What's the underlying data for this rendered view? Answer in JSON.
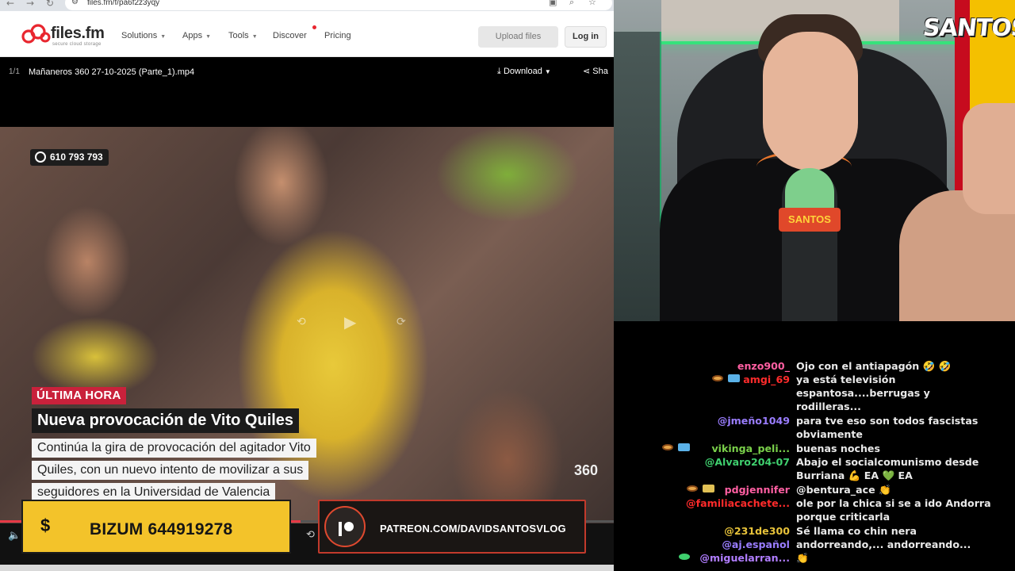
{
  "browser": {
    "url": "files.fm/f/pa6f2z3yqy",
    "logo_text": "files.fm",
    "logo_sub": "secure cloud storage",
    "menu": [
      {
        "label": "Solutions"
      },
      {
        "label": "Apps"
      },
      {
        "label": "Tools"
      },
      {
        "label": "Discover"
      },
      {
        "label": "Pricing"
      }
    ],
    "upload_label": "Upload files",
    "login_label": "Log in",
    "file_count": "1/1",
    "file_name": "Mañaneros 360 27-10-2025 (Parte_1).mp4",
    "download_label": "Download",
    "share_label": "Sha",
    "progress_fraction": 0.49
  },
  "video": {
    "whatsapp_number": "610 793 793",
    "tag": "ÚLTIMA HORA",
    "headline": "Nueva provocación de Vito Quiles",
    "lines": [
      "Continúa la gira de provocación del agitador Vito",
      "Quiles, con un nuevo intento de movilizar a sus",
      "seguidores en la Universidad de Valencia"
    ],
    "channel_logo": "360",
    "bizum_symbol": "$",
    "bizum_text": "BIZUM 644919278",
    "patreon_text": "PATREON.COM/DAVIDSANTOSVLOG",
    "colors": {
      "breaking": "#c9213b",
      "bizum": "#f3c32a",
      "patreon_border": "#c23a2c"
    }
  },
  "stream": {
    "logo": "SANTOS",
    "mic_label": "SANTOS"
  },
  "chat": {
    "messages": [
      {
        "user": "enzo900_",
        "color": "#ff5fa2",
        "badges": [],
        "text": "Ojo con el antiapagón 🤣 🤣"
      },
      {
        "user": "amgi_69",
        "color": "#ff2b2b",
        "badges": [
          "eye",
          "box"
        ],
        "text": "ya está televisión espantosa....berrugas y rodilleras..."
      },
      {
        "user": "@jmeño1049",
        "color": "#9a7dff",
        "badges": [],
        "text": "para tve eso son todos fascistas obviamente"
      },
      {
        "user": "vikinga_peli...",
        "color": "#7ad04a",
        "badges": [
          "eye",
          "box"
        ],
        "text": "buenas noches"
      },
      {
        "user": "@Alvaro204-07",
        "color": "#3fcf6e",
        "badges": [],
        "text": "Abajo el socialcomunismo desde Burriana 💪 EA 💚 EA"
      },
      {
        "user": "pdgjennifer",
        "color": "#ff5fa2",
        "badges": [
          "eye",
          "gold"
        ],
        "text": "@bentura_ace 👏"
      },
      {
        "user": "@familiacachete...",
        "color": "#ff2b2b",
        "badges": [],
        "text": "ole por la chica si se a ido Andorra porque criticarla"
      },
      {
        "user": "@231de300",
        "color": "#e8c33a",
        "badges": [],
        "text": "Sé llama co chin nera"
      },
      {
        "user": "@aj.español",
        "color": "#9a7dff",
        "badges": [],
        "text": "andorreando,... andorreando..."
      },
      {
        "user": "@miguelarran...",
        "color": "#b07dff",
        "badges": [
          "green"
        ],
        "text": "👏"
      }
    ]
  }
}
